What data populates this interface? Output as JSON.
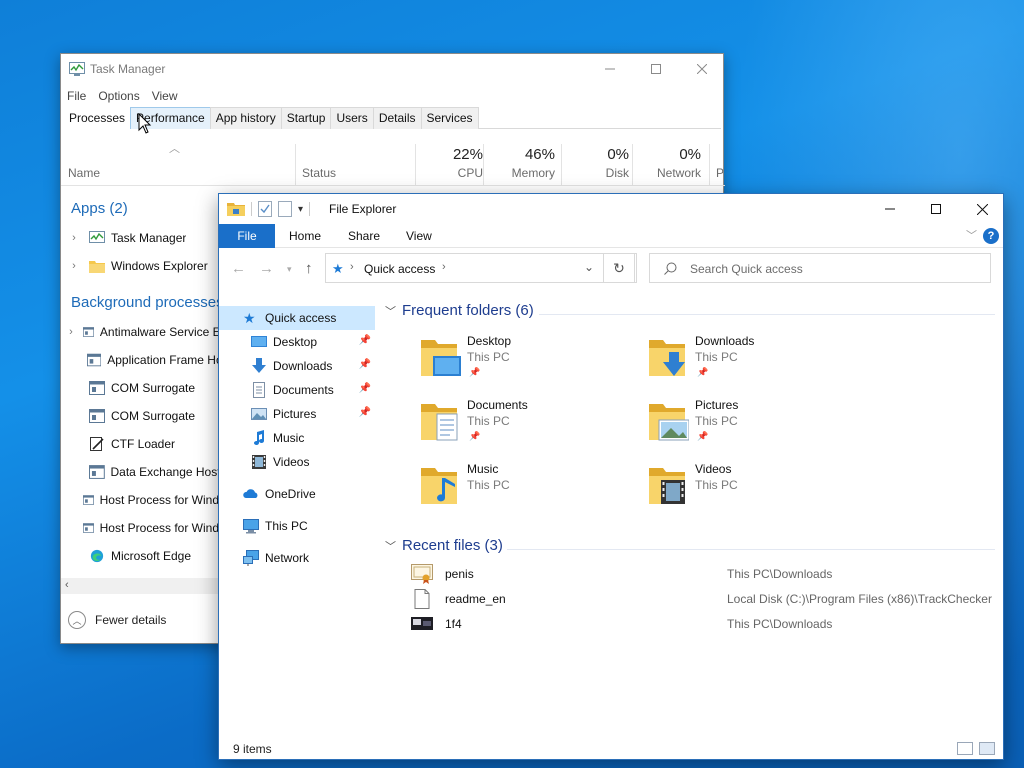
{
  "task_manager": {
    "title": "Task Manager",
    "menu": [
      "File",
      "Options",
      "View"
    ],
    "tabs": [
      "Processes",
      "Performance",
      "App history",
      "Startup",
      "Users",
      "Details",
      "Services"
    ],
    "columns": {
      "name": "Name",
      "status": "Status",
      "cpu": {
        "pct": "22%",
        "label": "CPU"
      },
      "memory": {
        "pct": "46%",
        "label": "Memory"
      },
      "disk": {
        "pct": "0%",
        "label": "Disk"
      },
      "network": {
        "pct": "0%",
        "label": "Network"
      },
      "overflow": "P"
    },
    "sections": {
      "apps": "Apps (2)",
      "background": "Background processes"
    },
    "apps": [
      "Task Manager",
      "Windows Explorer"
    ],
    "background": [
      "Antimalware Service Executable",
      "Application Frame Host",
      "COM Surrogate",
      "COM Surrogate",
      "CTF Loader",
      "Data Exchange Host",
      "Host Process for Windows Tasks",
      "Host Process for Windows Tasks",
      "Microsoft Edge"
    ],
    "footer": "Fewer details"
  },
  "file_explorer": {
    "title": "File Explorer",
    "ribbon_tabs": [
      "File",
      "Home",
      "Share",
      "View"
    ],
    "address": "Quick access",
    "search_placeholder": "Search Quick access",
    "nav": {
      "quick_access": "Quick access",
      "pinned": [
        "Desktop",
        "Downloads",
        "Documents",
        "Pictures"
      ],
      "unpinned": [
        "Music",
        "Videos"
      ],
      "onedrive": "OneDrive",
      "this_pc": "This PC",
      "network": "Network"
    },
    "frequent_header": "Frequent folders (6)",
    "folders": [
      {
        "name": "Desktop",
        "location": "This PC",
        "pinned": true
      },
      {
        "name": "Downloads",
        "location": "This PC",
        "pinned": true
      },
      {
        "name": "Documents",
        "location": "This PC",
        "pinned": true
      },
      {
        "name": "Pictures",
        "location": "This PC",
        "pinned": true
      },
      {
        "name": "Music",
        "location": "This PC",
        "pinned": false
      },
      {
        "name": "Videos",
        "location": "This PC",
        "pinned": false
      }
    ],
    "recent_header": "Recent files (3)",
    "recent": [
      {
        "name": "penis",
        "path": "This PC\\Downloads",
        "icon": "certificate-icon"
      },
      {
        "name": "readme_en",
        "path": "Local Disk (C:)\\Program Files (x86)\\TrackChecker",
        "icon": "text-file-icon"
      },
      {
        "name": "1f4",
        "path": "This PC\\Downloads",
        "icon": "image-file-icon"
      }
    ],
    "status": "9 items"
  },
  "colors": {
    "desktop": "#0f7fd8",
    "accent": "#1a6fc9",
    "section_blue": "#1e6bb8",
    "selection": "#cce8ff"
  }
}
